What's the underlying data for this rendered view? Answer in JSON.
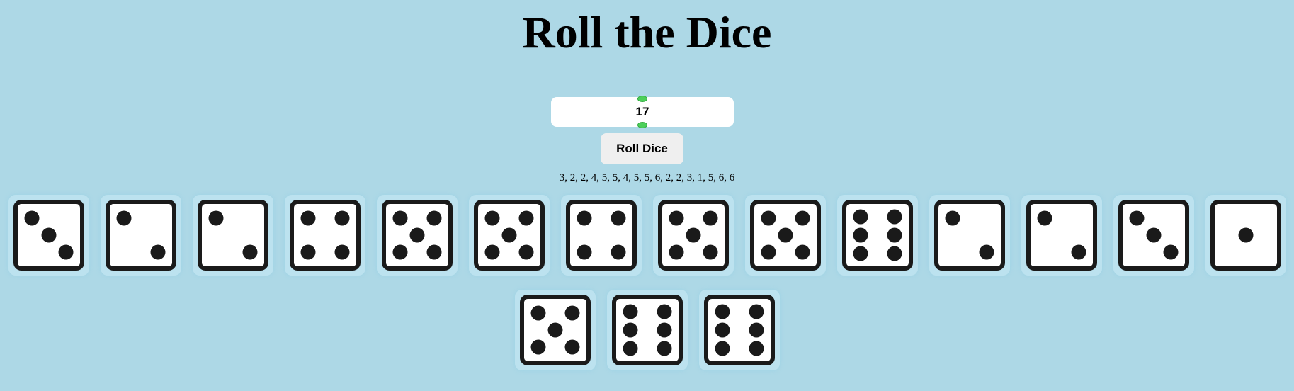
{
  "page": {
    "title": "Roll the Dice"
  },
  "controls": {
    "dice_count": "17",
    "roll_label": "Roll Dice"
  },
  "results": {
    "text": "3, 2, 2, 4, 5, 5, 4, 5, 5, 6, 2, 2, 3, 1, 5, 6, 6",
    "values": [
      3,
      2,
      2,
      4,
      5,
      5,
      4,
      5,
      5,
      6,
      2,
      2,
      3,
      1,
      5,
      6,
      6
    ]
  },
  "colors": {
    "background": "#add8e6",
    "die_face": "#ffffff",
    "die_border": "#1a1a1a",
    "pip": "#1a1a1a",
    "spinner": "#4ccf5a"
  },
  "icons": {
    "die": "die-face-icon"
  }
}
